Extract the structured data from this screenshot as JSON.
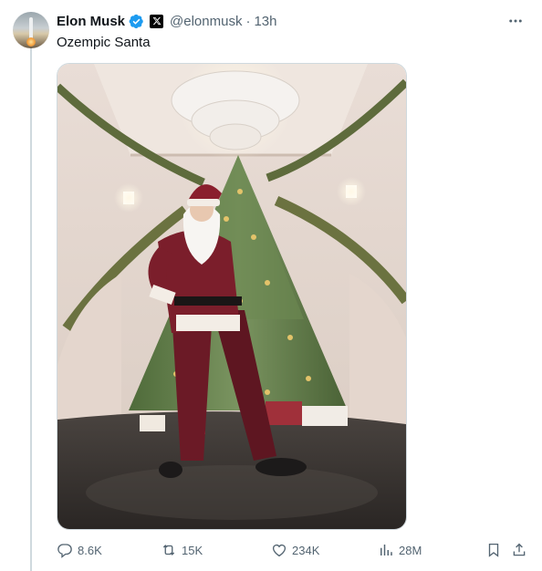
{
  "tweet": {
    "author_name": "Elon Musk",
    "handle": "@elonmusk",
    "separator": "·",
    "time": "13h",
    "text": "Ozempic Santa",
    "verified_color": "#1d9bf0"
  },
  "actions": {
    "replies": "8.6K",
    "reposts": "15K",
    "likes": "234K",
    "views": "28M"
  },
  "icons": [
    "verified-badge-icon",
    "x-logo-icon",
    "more-icon",
    "reply-icon",
    "repost-icon",
    "like-icon",
    "views-icon",
    "bookmark-icon",
    "share-icon"
  ]
}
